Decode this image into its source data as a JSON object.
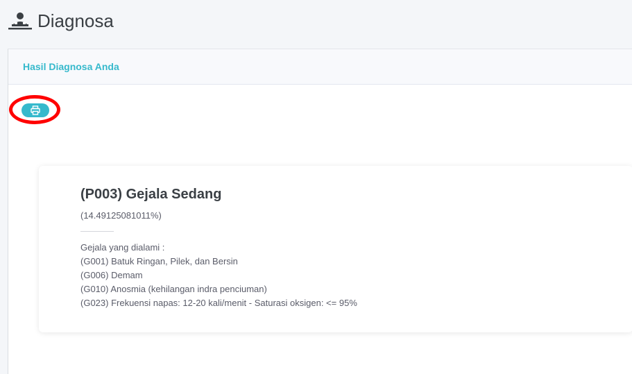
{
  "header": {
    "title": "Diagnosa",
    "icon": "user-md-icon"
  },
  "card": {
    "title": "Hasil Diagnosa Anda",
    "accent_color": "#36b9cc"
  },
  "toolbar": {
    "print_icon": "print-icon",
    "highlight_color": "#ff0000"
  },
  "result": {
    "title": "(P003) Gejala Sedang",
    "score": "(14.49125081011%)",
    "symptoms_heading": "Gejala yang dialami :",
    "symptoms": [
      "(G001) Batuk Ringan, Pilek, dan Bersin",
      "(G006) Demam",
      "(G010) Anosmia (kehilangan indra penciuman)",
      "(G023) Frekuensi napas: 12-20 kali/menit - Saturasi oksigen: <= 95%"
    ]
  }
}
